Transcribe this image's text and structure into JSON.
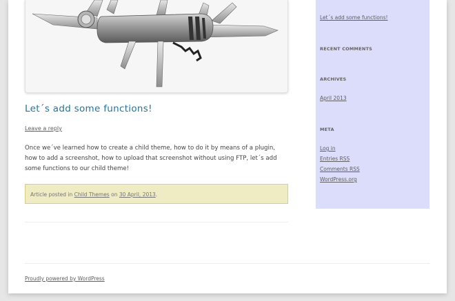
{
  "post": {
    "title": "Let´s add some functions!",
    "leave_reply": "Leave a reply",
    "excerpt": "Once we´ve learned how to create a child theme, how to do it by means of a plugin, how to add a screenshot, how to upload that screenshot without using FTP, let´s add some functions to our child theme!",
    "meta_prefix": "Article posted in",
    "category": "Child Themes",
    "meta_on": "on",
    "date": "30 April, 2013",
    "meta_end": "."
  },
  "sidebar": {
    "recent_post": "Let´s add some functions!",
    "recent_comments_title": "RECENT COMMENTS",
    "archives_title": "ARCHIVES",
    "archive_item": "April 2013",
    "meta_title": "META",
    "meta_links": [
      "Log in",
      "Entries RSS",
      "Comments RSS",
      "WordPress.org"
    ]
  },
  "footer": {
    "credit": "Proudly powered by WordPress"
  },
  "colors": {
    "title_blue": "#21759b",
    "sidebar_bg": "#dcdcfb",
    "meta_box_bg": "#efebc3"
  }
}
